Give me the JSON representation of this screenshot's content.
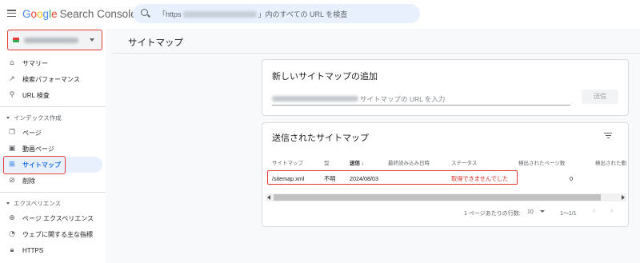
{
  "app": {
    "logo_google": [
      "G",
      "o",
      "o",
      "g",
      "l",
      "e"
    ],
    "logo_product": "Search Console"
  },
  "search": {
    "prefix": "「https",
    "suffix": "」内のすべての URL を検査"
  },
  "sidebar": {
    "items_top": [
      {
        "label": "サマリー",
        "icon": "home-icon"
      },
      {
        "label": "検索パフォーマンス",
        "icon": "trending-up-icon"
      },
      {
        "label": "URL 検査",
        "icon": "search-icon"
      }
    ],
    "section_index": "インデックス作成",
    "items_index": [
      {
        "label": "ページ",
        "icon": "file-copy-icon"
      },
      {
        "label": "動画ページ",
        "icon": "video-page-icon"
      },
      {
        "label": "サイトマップ",
        "icon": "sitemap-icon",
        "active": true
      },
      {
        "label": "削除",
        "icon": "eye-off-icon"
      }
    ],
    "section_experience": "エクスペリエンス",
    "items_experience": [
      {
        "label": "ページ エクスペリエンス",
        "icon": "plus-circle-icon"
      },
      {
        "label": "ウェブに関する主な指標",
        "icon": "speedometer-icon"
      },
      {
        "label": "HTTPS",
        "icon": "lock-icon"
      }
    ]
  },
  "main": {
    "page_title": "サイトマップ",
    "add_card": {
      "title": "新しいサイトマップの追加",
      "input_placeholder": "サイトマップの URL を入力",
      "submit_label": "送信"
    },
    "submitted_card": {
      "title": "送信されたサイトマップ",
      "columns": [
        "サイトマップ",
        "型",
        "送信 ↓",
        "最終読み込み日時",
        "ステータス",
        "検出されたページ数",
        "検出された動"
      ],
      "rows": [
        {
          "sitemap": "/sitemap.xml",
          "type": "不明",
          "submitted": "2024/08/03",
          "last_read": "",
          "status": "取得できませんでした",
          "pages": "0",
          "videos": ""
        }
      ],
      "pagination": {
        "rows_per_page_label": "1 ページあたりの行数:",
        "rows_per_page": "10",
        "range": "1〜1/1",
        "prev": "‹",
        "next": "›"
      }
    }
  },
  "colors": {
    "accent": "#1a73e8",
    "active_bg": "#e8f0fe",
    "error": "#d93025",
    "highlight_box": "#e53935"
  }
}
